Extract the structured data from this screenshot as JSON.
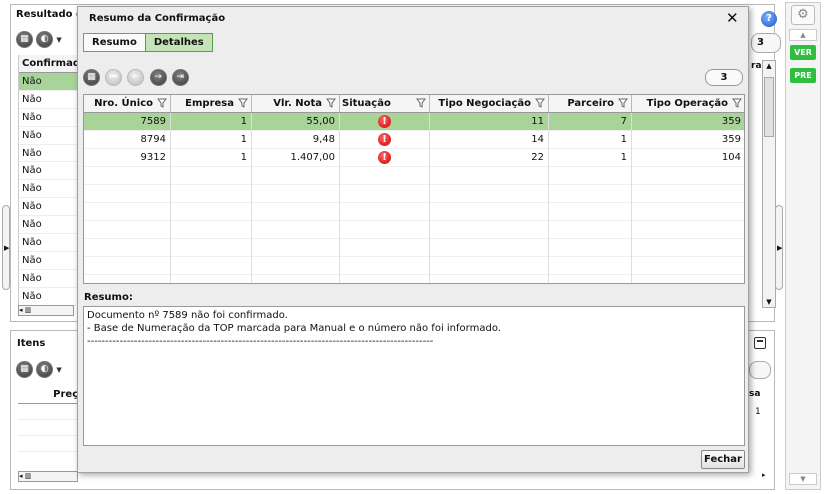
{
  "background": {
    "results_title": "Resultado d",
    "results_right_count": "3",
    "results_column": "Confirmada",
    "results_rows": [
      "Não",
      "Não",
      "Não",
      "Não",
      "Não",
      "Não",
      "Não",
      "Não",
      "Não",
      "Não",
      "Não",
      "Não",
      "Não"
    ],
    "results_col_right": "ra",
    "items_title": "Itens",
    "items_column": "Preço",
    "items_col_right": "sa",
    "items_value_right": "1"
  },
  "action_bar": {
    "ver_label": "VER",
    "pre_label": "PRE"
  },
  "modal": {
    "title": "Resumo da Confirmação",
    "tabs": [
      {
        "label": "Resumo",
        "active": false
      },
      {
        "label": "Detalhes",
        "active": true
      }
    ],
    "record_count": "3",
    "columns": [
      "Nro. Único",
      "Empresa",
      "Vlr. Nota",
      "Situação",
      "Tipo Negociação",
      "Parceiro",
      "Tipo Operação"
    ],
    "rows": [
      {
        "nro": "7589",
        "empresa": "1",
        "vlr": "55,00",
        "neg": "11",
        "parceiro": "7",
        "top": "359"
      },
      {
        "nro": "8794",
        "empresa": "1",
        "vlr": "9,48",
        "neg": "14",
        "parceiro": "1",
        "top": "359"
      },
      {
        "nro": "9312",
        "empresa": "1",
        "vlr": "1.407,00",
        "neg": "22",
        "parceiro": "1",
        "top": "104"
      }
    ],
    "summary_label": "Resumo:",
    "summary_text": "Documento nº 7589 não foi confirmado.\n- Base de Numeração da TOP marcada para Manual e o número não foi informado.\n------------------------------------------------------------------------------------------------",
    "close_button": "Fechar"
  },
  "colors": {
    "selected_row": "#a8d49a",
    "active_tab": "#c4e4b8",
    "tag_green": "#2fbf3f",
    "warning_red": "#cc0000"
  }
}
